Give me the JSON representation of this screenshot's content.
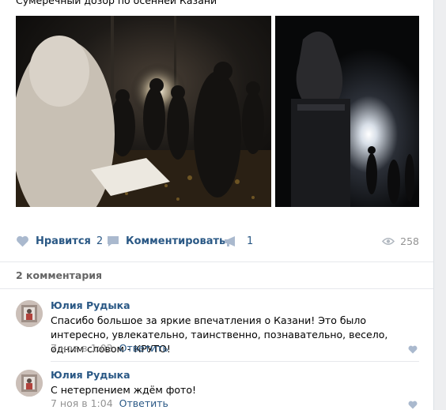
{
  "post": {
    "text": "Сумеречный дозор по осенней Казани",
    "photos": [
      {
        "icon": "night-group-reading-photo"
      },
      {
        "icon": "monument-night-light-photo"
      }
    ]
  },
  "actions": {
    "like_label": "Нравится",
    "like_count": "2",
    "comment_label": "Комментировать",
    "share_count": "1",
    "views_count": "258"
  },
  "comments_header": "2 комментария",
  "comments": [
    {
      "author": "Юлия Рудыка",
      "text": "Спасибо большое за яркие впечатления о Казани! Это было интересно, увлекательно, таинственно, познавательно, весело, одним словом - КРУТО!",
      "date": "7 ноя в 1:02",
      "reply": "Ответить"
    },
    {
      "author": "Юлия Рудыка",
      "text": "С нетерпением ждём фото!",
      "date": "7 ноя в 1:04",
      "reply": "Ответить"
    }
  ],
  "colors": {
    "link": "#2a5885",
    "muted": "#939393",
    "header": "#656565",
    "icon": "#aab9ce"
  }
}
